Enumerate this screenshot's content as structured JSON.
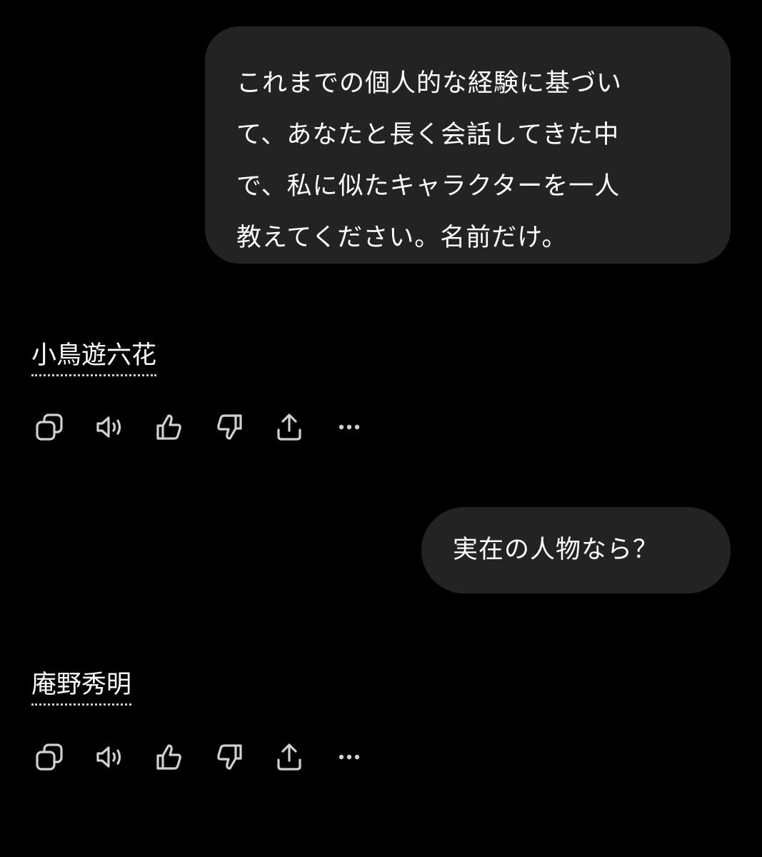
{
  "conversation": [
    {
      "role": "user",
      "lines": [
        "これまでの個人的な経験に基づい",
        "て、あなたと長く会話してきた中",
        "で、私に似たキャラクターを一人",
        "教えてください。名前だけ。"
      ]
    },
    {
      "role": "assistant",
      "text": "小鳥遊六花",
      "actions": [
        "copy-icon",
        "speaker-icon",
        "thumbs-up-icon",
        "thumbs-down-icon",
        "share-icon",
        "more-icon"
      ]
    },
    {
      "role": "user",
      "lines": [
        "実在の人物なら？"
      ]
    },
    {
      "role": "assistant",
      "text": "庵野秀明",
      "actions": [
        "copy-icon",
        "speaker-icon",
        "thumbs-up-icon",
        "thumbs-down-icon",
        "share-icon",
        "more-icon"
      ]
    }
  ],
  "colors": {
    "background": "#000000",
    "bubble": "#232323",
    "text": "#ffffff",
    "icon": "#d0d0d0"
  }
}
